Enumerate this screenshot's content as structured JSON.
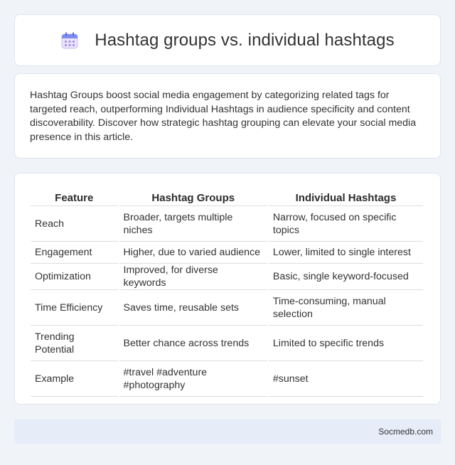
{
  "header": {
    "icon": "calendar-icon",
    "title": "Hashtag groups vs. individual hashtags"
  },
  "intro": {
    "text": "Hashtag Groups boost social media engagement by categorizing related tags for targeted reach, outperforming Individual Hashtags in audience specificity and content discoverability. Discover how strategic hashtag grouping can elevate your social media presence in this article."
  },
  "table": {
    "headers": [
      "Feature",
      "Hashtag Groups",
      "Individual Hashtags"
    ],
    "rows": [
      [
        "Reach",
        "Broader, targets multiple niches",
        "Narrow, focused on specific topics"
      ],
      [
        "Engagement",
        "Higher, due to varied audience",
        "Lower, limited to single interest"
      ],
      [
        "Optimization",
        "Improved, for diverse keywords",
        "Basic, single keyword-focused"
      ],
      [
        "Time Efficiency",
        "Saves time, reusable sets",
        "Time-consuming, manual selection"
      ],
      [
        "Trending Potential",
        "Better chance across trends",
        "Limited to specific trends"
      ],
      [
        "Example",
        "#travel #adventure #photography",
        "#sunset"
      ]
    ]
  },
  "footer": {
    "site": "Socmedb.com"
  },
  "colors": {
    "background": "#f0f3f8",
    "card": "#ffffff",
    "footer": "#e6edf8",
    "text": "#333333"
  }
}
